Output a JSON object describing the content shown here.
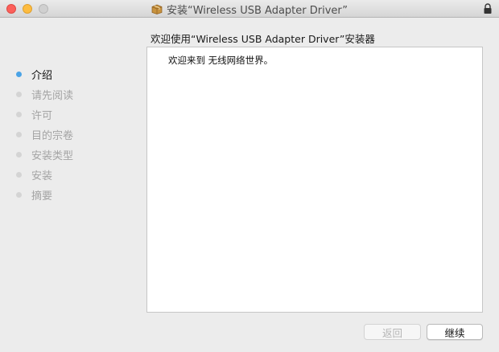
{
  "window": {
    "title": "安装“Wireless USB Adapter Driver”"
  },
  "heading": "欢迎使用“Wireless USB Adapter Driver”安装器",
  "steps": [
    {
      "label": "介绍",
      "active": true
    },
    {
      "label": "请先阅读",
      "active": false
    },
    {
      "label": "许可",
      "active": false
    },
    {
      "label": "目的宗卷",
      "active": false
    },
    {
      "label": "安装类型",
      "active": false
    },
    {
      "label": "安装",
      "active": false
    },
    {
      "label": "摘要",
      "active": false
    }
  ],
  "content": {
    "welcome_text": "欢迎来到 无线网络世界。"
  },
  "buttons": {
    "back_label": "返回",
    "back_enabled": false,
    "continue_label": "继续"
  },
  "colors": {
    "active_step_dot": "#4aa3e6",
    "inactive_step_dot": "#d4d4d4",
    "window_background": "#ececec",
    "close_button": "#fc605b",
    "minimize_button": "#fdbc40"
  },
  "icons": {
    "title": "package-icon",
    "titlebar_right": "lock-icon"
  }
}
